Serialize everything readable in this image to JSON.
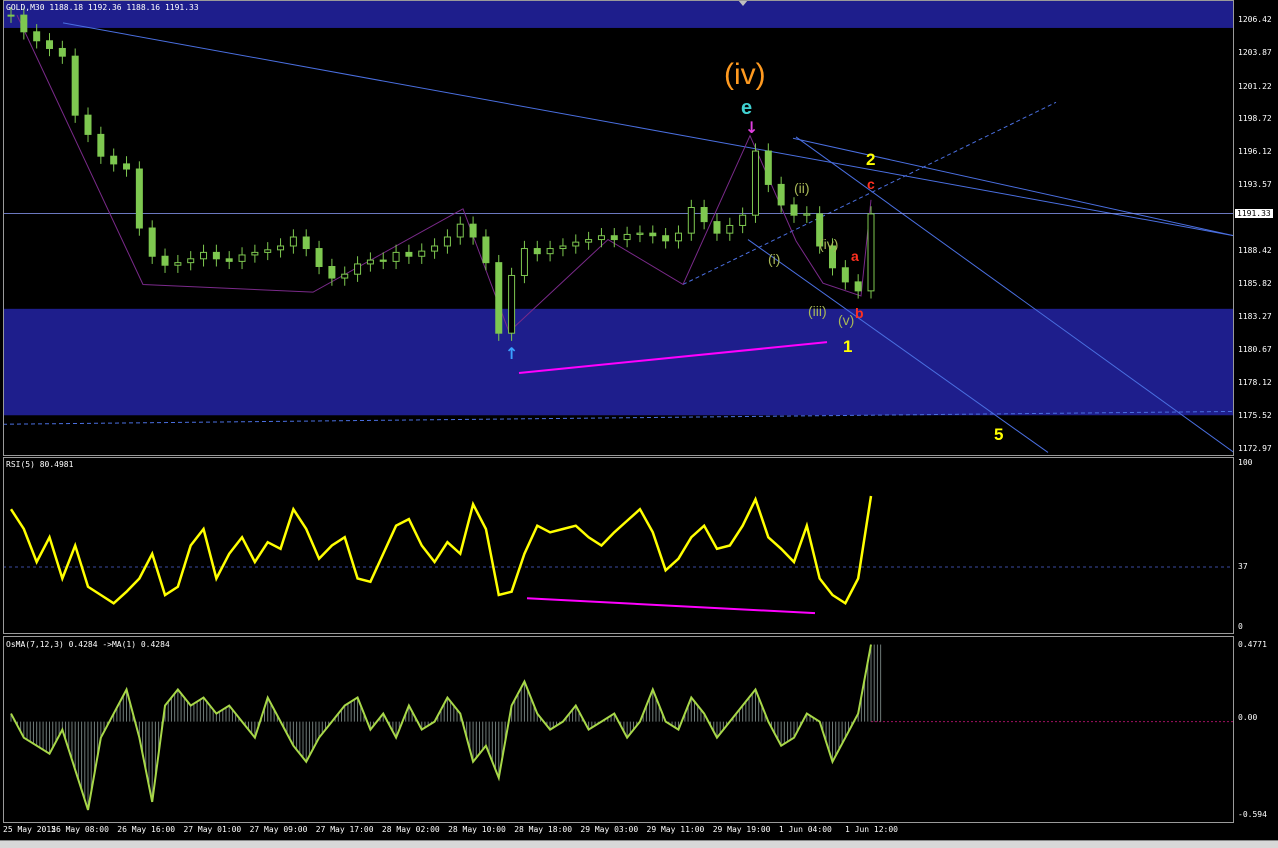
{
  "symbol_header": "GOLD,M30  1188.18 1192.36 1188.16 1191.33",
  "current_price": "1191.33",
  "price_axis": [
    "1206.42",
    "1203.87",
    "1201.22",
    "1198.72",
    "1196.12",
    "1193.57",
    "1191.33",
    "1188.42",
    "1185.82",
    "1183.27",
    "1180.67",
    "1178.12",
    "1175.52",
    "1172.97"
  ],
  "rsi_header": "RSI(5) 80.4981",
  "rsi_axis": [
    "100",
    "37",
    "0"
  ],
  "osma_header": "OsMA(7,12,3) 0.4284  ->MA(1) 0.4284",
  "osma_axis": [
    "0.4771",
    "0.00",
    "-0.594"
  ],
  "time_axis": [
    "25 May 2015",
    "26 May 08:00",
    "26 May 16:00",
    "27 May 01:00",
    "27 May 09:00",
    "27 May 17:00",
    "28 May 02:00",
    "28 May 10:00",
    "28 May 18:00",
    "29 May 03:00",
    "29 May 11:00",
    "29 May 19:00",
    "1 Jun 04:00",
    "1 Jun 12:00"
  ],
  "wave_labels": {
    "iv_big": "(iv)",
    "e": "e",
    "ii": "(ii)",
    "i": "(i)",
    "iv_small": "(iv)",
    "iii": "(iii)",
    "v": "(v)",
    "a": "a",
    "b": "b",
    "c": "c",
    "two": "2",
    "one": "1",
    "five": "5"
  },
  "colors": {
    "background": "#000000",
    "candles": "#7ec850",
    "zone": "#1e1e8c",
    "trendline": "#4a6fe0",
    "rsi": "#ffff00",
    "divergence": "#ff00ff",
    "osma_line": "#a8d848",
    "orange": "#ff9a20",
    "cyan": "#40d0d0",
    "olive": "#a8b858",
    "red": "#ff3020",
    "yellow": "#ffff00"
  },
  "chart_data": [
    {
      "type": "candlestick",
      "title": "GOLD,M30",
      "x_range": [
        "25 May 2015",
        "1 Jun 12:00"
      ],
      "ylim": [
        1172.97,
        1206.42
      ],
      "ohlc_last": {
        "open": 1188.18,
        "high": 1192.36,
        "low": 1188.16,
        "close": 1191.33
      },
      "close_series": [
        1206.8,
        1205.5,
        1204.8,
        1204.2,
        1203.6,
        1199.0,
        1197.5,
        1195.8,
        1195.2,
        1194.8,
        1190.2,
        1188.0,
        1187.3,
        1187.5,
        1187.8,
        1188.3,
        1187.8,
        1187.6,
        1188.1,
        1188.3,
        1188.5,
        1188.8,
        1189.5,
        1188.6,
        1187.2,
        1186.3,
        1186.6,
        1187.4,
        1187.7,
        1187.6,
        1188.3,
        1188.0,
        1188.4,
        1188.8,
        1189.5,
        1190.5,
        1189.5,
        1187.5,
        1182.0,
        1186.5,
        1188.6,
        1188.2,
        1188.6,
        1188.8,
        1189.1,
        1189.3,
        1189.6,
        1189.3,
        1189.7,
        1189.8,
        1189.6,
        1189.2,
        1189.8,
        1191.8,
        1190.7,
        1189.8,
        1190.4,
        1191.2,
        1196.2,
        1193.6,
        1192.0,
        1191.2,
        1191.3,
        1188.8,
        1187.1,
        1186.0,
        1185.3,
        1191.3
      ]
    },
    {
      "type": "line",
      "title": "RSI(5)",
      "last": 80.4981,
      "ylim": [
        0,
        100
      ],
      "level": 37,
      "values": [
        72,
        60,
        40,
        55,
        30,
        50,
        25,
        20,
        15,
        22,
        30,
        45,
        20,
        25,
        50,
        60,
        30,
        45,
        55,
        40,
        52,
        48,
        72,
        60,
        42,
        50,
        55,
        30,
        28,
        45,
        62,
        66,
        50,
        40,
        52,
        45,
        75,
        60,
        20,
        22,
        45,
        62,
        58,
        60,
        62,
        55,
        50,
        58,
        65,
        72,
        58,
        35,
        42,
        55,
        62,
        48,
        50,
        62,
        78,
        55,
        48,
        40,
        62,
        30,
        20,
        15,
        30,
        80
      ]
    },
    {
      "type": "bar",
      "title": "OsMA(7,12,3)",
      "last": 0.4284,
      "ylim": [
        -0.594,
        0.4771
      ],
      "values": [
        0.05,
        -0.1,
        -0.15,
        -0.2,
        -0.05,
        -0.3,
        -0.55,
        -0.1,
        0.05,
        0.2,
        -0.1,
        -0.5,
        0.1,
        0.2,
        0.1,
        0.15,
        0.05,
        0.1,
        0.0,
        -0.1,
        0.15,
        0.0,
        -0.15,
        -0.25,
        -0.1,
        0.0,
        0.1,
        0.15,
        -0.05,
        0.05,
        -0.1,
        0.1,
        -0.05,
        0.0,
        0.15,
        0.05,
        -0.25,
        -0.15,
        -0.35,
        0.1,
        0.25,
        0.05,
        -0.05,
        0.0,
        0.1,
        -0.05,
        0.0,
        0.05,
        -0.1,
        0.0,
        0.2,
        0.0,
        -0.05,
        0.15,
        0.05,
        -0.1,
        0.0,
        0.1,
        0.2,
        0.0,
        -0.15,
        -0.1,
        0.05,
        0.0,
        -0.25,
        -0.1,
        0.05,
        0.48
      ]
    }
  ]
}
